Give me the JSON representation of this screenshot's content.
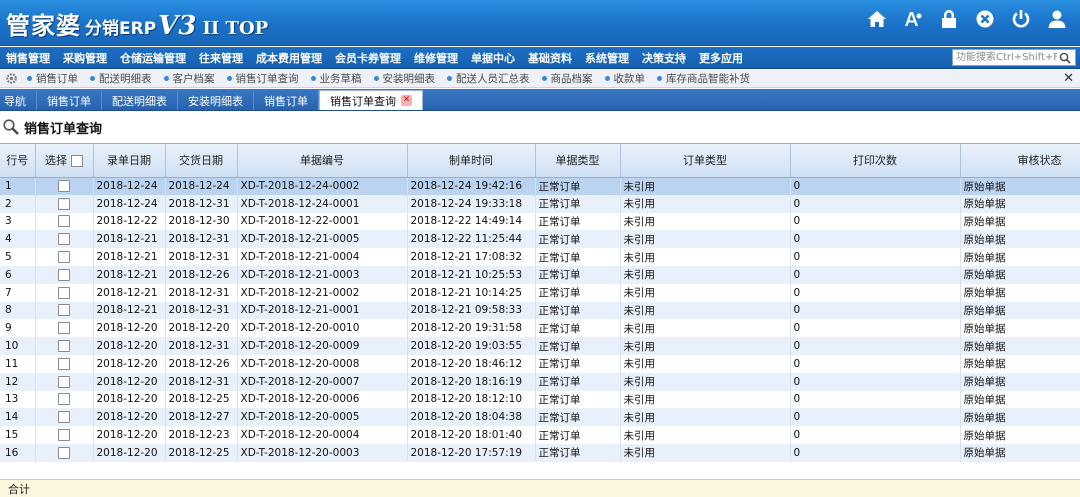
{
  "app": {
    "logo_main": "管家婆",
    "logo_sub": "分销ERP",
    "logo_v": "V3",
    "logo_ver": "II TOP"
  },
  "top_icons": [
    "home-icon",
    "font-icon",
    "lock-icon",
    "close-circle-icon",
    "power-icon",
    "user-icon"
  ],
  "main_menu": [
    "销售管理",
    "采购管理",
    "仓储运输管理",
    "往来管理",
    "成本费用管理",
    "会员卡券管理",
    "维修管理",
    "单据中心",
    "基础资料",
    "系统管理",
    "决策支持",
    "更多应用"
  ],
  "search": {
    "placeholder": "功能搜索Ctrl+Shift+F"
  },
  "quick_links": [
    "销售订单",
    "配送明细表",
    "客户档案",
    "销售订单查询",
    "业务草稿",
    "安装明细表",
    "配送人员汇总表",
    "商品档案",
    "收款单",
    "库存商品智能补货"
  ],
  "tabs": [
    {
      "label": "导航",
      "active": false
    },
    {
      "label": "销售订单",
      "active": false
    },
    {
      "label": "配送明细表",
      "active": false
    },
    {
      "label": "安装明细表",
      "active": false
    },
    {
      "label": "销售订单",
      "active": false
    },
    {
      "label": "销售订单查询",
      "active": true
    }
  ],
  "page_title": "销售订单查询",
  "table": {
    "columns": [
      "行号",
      "选择",
      "录单日期",
      "交货日期",
      "单据编号",
      "制单时间",
      "单据类型",
      "订单类型",
      "打印次数",
      "审核状态"
    ],
    "rows": [
      [
        "1",
        "2018-12-24",
        "2018-12-24",
        "XD-T-2018-12-24-0002",
        "2018-12-24 19:42:16",
        "正常订单",
        "未引用",
        "0",
        "原始单据"
      ],
      [
        "2",
        "2018-12-24",
        "2018-12-31",
        "XD-T-2018-12-24-0001",
        "2018-12-24 19:33:18",
        "正常订单",
        "未引用",
        "0",
        "原始单据"
      ],
      [
        "3",
        "2018-12-22",
        "2018-12-30",
        "XD-T-2018-12-22-0001",
        "2018-12-22 14:49:14",
        "正常订单",
        "未引用",
        "0",
        "原始单据"
      ],
      [
        "4",
        "2018-12-21",
        "2018-12-31",
        "XD-T-2018-12-21-0005",
        "2018-12-22 11:25:44",
        "正常订单",
        "未引用",
        "0",
        "原始单据"
      ],
      [
        "5",
        "2018-12-21",
        "2018-12-31",
        "XD-T-2018-12-21-0004",
        "2018-12-21 17:08:32",
        "正常订单",
        "未引用",
        "0",
        "原始单据"
      ],
      [
        "6",
        "2018-12-21",
        "2018-12-26",
        "XD-T-2018-12-21-0003",
        "2018-12-21 10:25:53",
        "正常订单",
        "未引用",
        "0",
        "原始单据"
      ],
      [
        "7",
        "2018-12-21",
        "2018-12-31",
        "XD-T-2018-12-21-0002",
        "2018-12-21 10:14:25",
        "正常订单",
        "未引用",
        "0",
        "原始单据"
      ],
      [
        "8",
        "2018-12-21",
        "2018-12-31",
        "XD-T-2018-12-21-0001",
        "2018-12-21 09:58:33",
        "正常订单",
        "未引用",
        "0",
        "原始单据"
      ],
      [
        "9",
        "2018-12-20",
        "2018-12-20",
        "XD-T-2018-12-20-0010",
        "2018-12-20 19:31:58",
        "正常订单",
        "未引用",
        "0",
        "原始单据"
      ],
      [
        "10",
        "2018-12-20",
        "2018-12-31",
        "XD-T-2018-12-20-0009",
        "2018-12-20 19:03:55",
        "正常订单",
        "未引用",
        "0",
        "原始单据"
      ],
      [
        "11",
        "2018-12-20",
        "2018-12-26",
        "XD-T-2018-12-20-0008",
        "2018-12-20 18:46:12",
        "正常订单",
        "未引用",
        "0",
        "原始单据"
      ],
      [
        "12",
        "2018-12-20",
        "2018-12-31",
        "XD-T-2018-12-20-0007",
        "2018-12-20 18:16:19",
        "正常订单",
        "未引用",
        "0",
        "原始单据"
      ],
      [
        "13",
        "2018-12-20",
        "2018-12-25",
        "XD-T-2018-12-20-0006",
        "2018-12-20 18:12:10",
        "正常订单",
        "未引用",
        "0",
        "原始单据"
      ],
      [
        "14",
        "2018-12-20",
        "2018-12-27",
        "XD-T-2018-12-20-0005",
        "2018-12-20 18:04:38",
        "正常订单",
        "未引用",
        "0",
        "原始单据"
      ],
      [
        "15",
        "2018-12-20",
        "2018-12-23",
        "XD-T-2018-12-20-0004",
        "2018-12-20 18:01:40",
        "正常订单",
        "未引用",
        "0",
        "原始单据"
      ],
      [
        "16",
        "2018-12-20",
        "2018-12-25",
        "XD-T-2018-12-20-0003",
        "2018-12-20 17:57:19",
        "正常订单",
        "未引用",
        "0",
        "原始单据"
      ]
    ],
    "selected_row": 1
  },
  "footer": {
    "sum_label": "合计"
  },
  "colors": {
    "banner": "#1a72c8",
    "menu": "#1560b0",
    "row_alt": "#e8f1fb",
    "row_selected": "#b9d3f1",
    "sum_row": "#fbf6dc"
  }
}
